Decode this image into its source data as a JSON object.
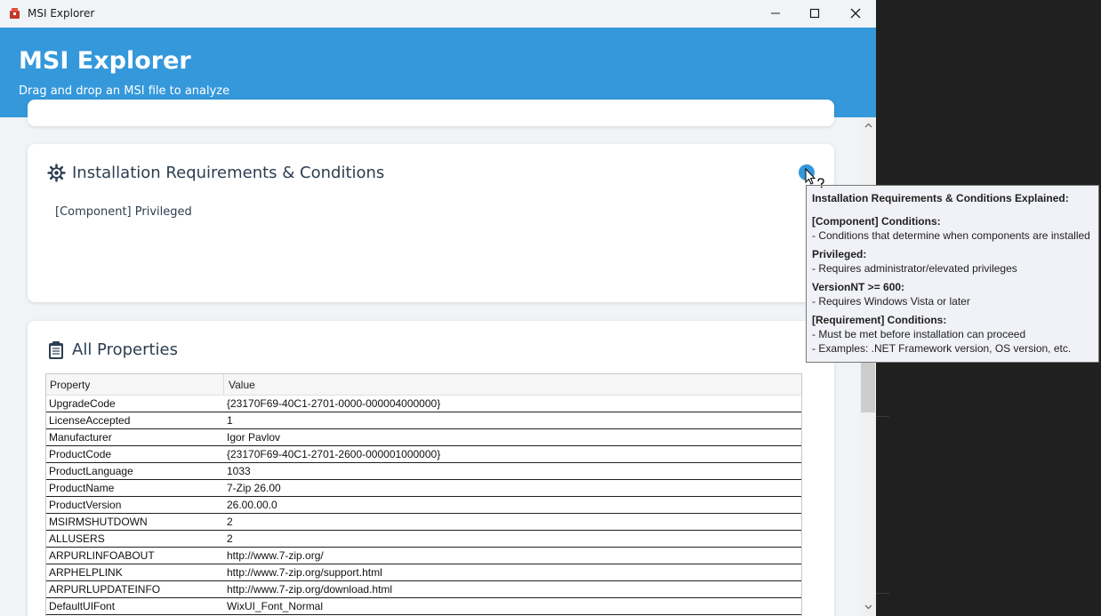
{
  "window": {
    "title": "MSI Explorer",
    "app_icon": "msi-package-icon",
    "controls": [
      "minimize-icon",
      "maximize-icon",
      "close-icon"
    ]
  },
  "header": {
    "title": "MSI Explorer",
    "subtitle": "Drag and drop an MSI file to analyze",
    "color": "#3498db"
  },
  "requirements": {
    "icon": "gear-icon",
    "title": "Installation Requirements & Conditions",
    "text": "[Component] Privileged",
    "info_icon": "info-icon"
  },
  "tooltip": {
    "title": "Installation Requirements & Conditions Explained:",
    "sections": [
      {
        "heading": "[Component] Conditions:",
        "lines": [
          "- Conditions that determine when components are installed"
        ]
      },
      {
        "heading": "Privileged:",
        "lines": [
          "- Requires administrator/elevated privileges"
        ]
      },
      {
        "heading": "VersionNT >= 600:",
        "lines": [
          "- Requires Windows Vista or later"
        ]
      },
      {
        "heading": "[Requirement] Conditions:",
        "lines": [
          "- Must be met before installation can proceed",
          "- Examples: .NET Framework version, OS version, etc."
        ]
      }
    ]
  },
  "properties": {
    "icon": "clipboard-icon",
    "title": "All Properties",
    "columns": [
      "Property",
      "Value"
    ],
    "rows": [
      [
        "UpgradeCode",
        "{23170F69-40C1-2701-0000-000004000000}"
      ],
      [
        "LicenseAccepted",
        "1"
      ],
      [
        "Manufacturer",
        "Igor Pavlov"
      ],
      [
        "ProductCode",
        "{23170F69-40C1-2701-2600-000001000000}"
      ],
      [
        "ProductLanguage",
        "1033"
      ],
      [
        "ProductName",
        "7-Zip 26.00"
      ],
      [
        "ProductVersion",
        "26.00.00.0"
      ],
      [
        "MSIRMSHUTDOWN",
        "2"
      ],
      [
        "ALLUSERS",
        "2"
      ],
      [
        "ARPURLINFOABOUT",
        "http://www.7-zip.org/"
      ],
      [
        "ARPHELPLINK",
        "http://www.7-zip.org/support.html"
      ],
      [
        "ARPURLUPDATEINFO",
        "http://www.7-zip.org/download.html"
      ],
      [
        "DefaultUIFont",
        "WixUI_Font_Normal"
      ]
    ]
  }
}
